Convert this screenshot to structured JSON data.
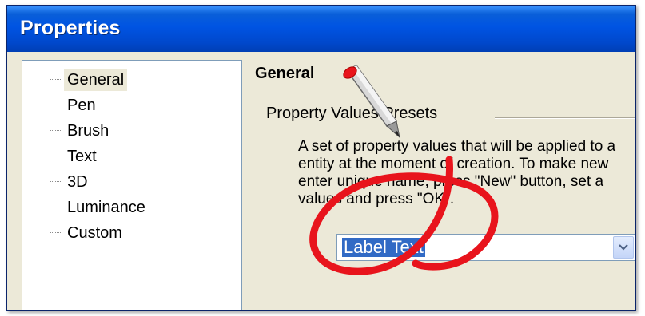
{
  "window": {
    "title": "Properties"
  },
  "tree": {
    "items": [
      {
        "label": "General",
        "selected": true
      },
      {
        "label": "Pen"
      },
      {
        "label": "Brush"
      },
      {
        "label": "Text"
      },
      {
        "label": "3D"
      },
      {
        "label": "Luminance"
      },
      {
        "label": "Custom"
      }
    ]
  },
  "panel": {
    "header": "General",
    "group_title": "Property Values Presets",
    "description": [
      "A set of property values that will be applied to a",
      "entity at the moment of creation. To make new",
      "enter unique name, press \"New\" button, set a",
      "values and press \"OK\"."
    ],
    "combo": {
      "value": "Label Text"
    }
  },
  "colors": {
    "titlebar": "#0054e3",
    "annotation_circle": "#e8141c",
    "selection": "#316ac5"
  }
}
